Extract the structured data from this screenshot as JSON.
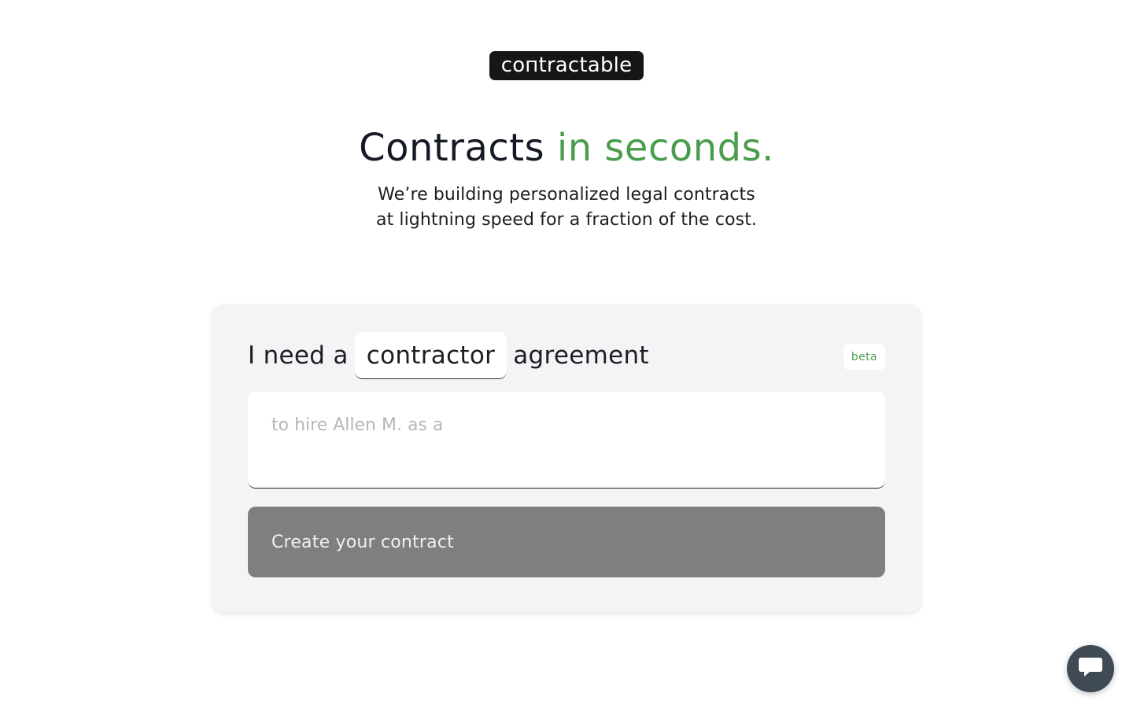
{
  "logo": {
    "text": "coпtractable"
  },
  "hero": {
    "title_main": "Contracts",
    "title_accent": "in seconds.",
    "subtitle_line1": "We’re building personalized legal contracts",
    "subtitle_line2": "at lightning speed for a fraction of the cost."
  },
  "form": {
    "need_prefix": "I need a",
    "agreement_type": "contractor",
    "need_suffix": "agreement",
    "beta_label": "beta",
    "details_placeholder": "to hire Allen M. as a",
    "details_value": "",
    "submit_label": "Create your contract"
  },
  "chat": {
    "icon": "chat-bubble-icon"
  },
  "colors": {
    "accent_green": "#4a9d4d",
    "text_dark": "#151a26",
    "card_bg": "#f3f4f6",
    "button_disabled": "#7f7f7f",
    "chat_bg": "#3f4a55"
  }
}
